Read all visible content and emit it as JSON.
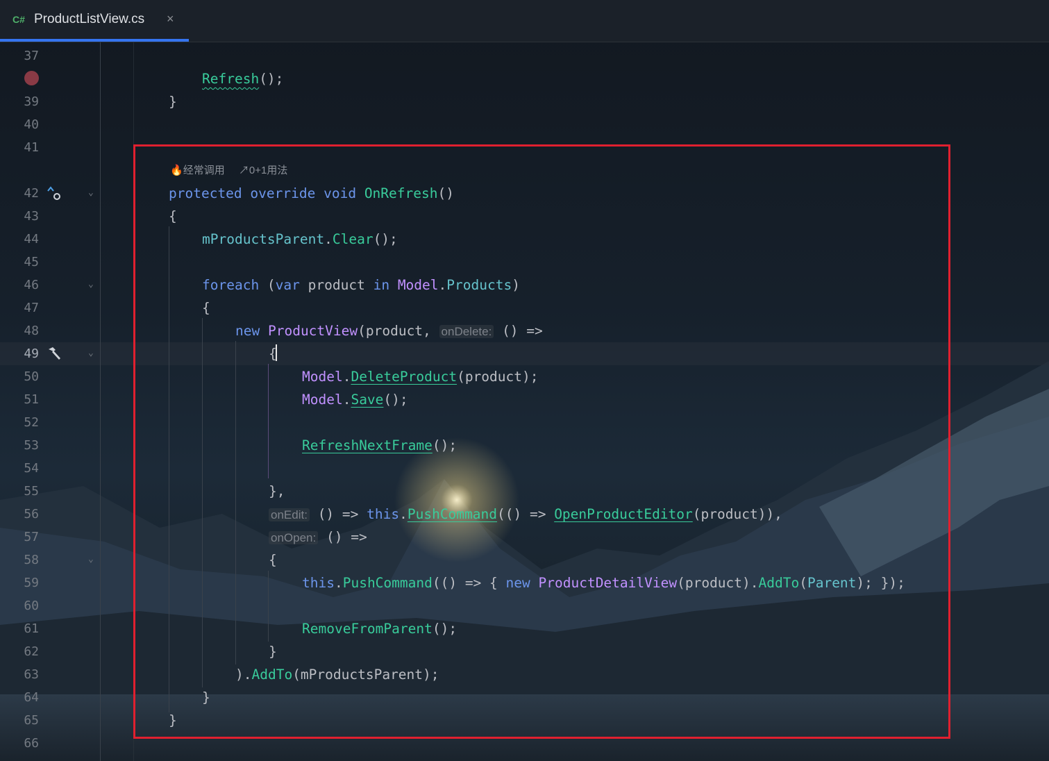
{
  "tab": {
    "lang": "C#",
    "filename": "ProductListView.cs",
    "close": "×"
  },
  "code_lens": {
    "usage_frequent": "经常调用",
    "usages": "0+1用法"
  },
  "hints": {
    "onDelete": "onDelete:",
    "onEdit": "onEdit:",
    "onOpen": "onOpen:"
  },
  "line_numbers": [
    "37",
    "39",
    "40",
    "41",
    "42",
    "43",
    "44",
    "45",
    "46",
    "47",
    "48",
    "49",
    "50",
    "51",
    "52",
    "53",
    "54",
    "55",
    "56",
    "57",
    "58",
    "59",
    "60",
    "61",
    "62",
    "63",
    "64",
    "65",
    "66"
  ],
  "code": {
    "l38_fn": "Refresh",
    "l38_rest": "();",
    "l39": "}",
    "l42_kw1": "protected",
    "l42_kw2": "override",
    "l42_kw3": "void",
    "l42_fn": "OnRefresh",
    "l42_rest": "()",
    "l43": "{",
    "l44_fld": "mProductsParent",
    "l44_dot": ".",
    "l44_fn": "Clear",
    "l44_rest": "();",
    "l46_kw1": "foreach",
    "l46_p1": " (",
    "l46_kw2": "var",
    "l46_p2": " product ",
    "l46_kw3": "in",
    "l46_ty": "Model",
    "l46_dot": ".",
    "l46_fld": "Products",
    "l46_end": ")",
    "l47": "{",
    "l48_kw": "new",
    "l48_ty": "ProductView",
    "l48_p1": "(product, ",
    "l48_end": "() =>",
    "l49": "{",
    "l50_ty": "Model",
    "l50_dot": ".",
    "l50_fn": "DeleteProduct",
    "l50_end": "(product);",
    "l51_ty": "Model",
    "l51_dot": ".",
    "l51_fn": "Save",
    "l51_end": "();",
    "l53_fn": "RefreshNextFrame",
    "l53_end": "();",
    "l55": "},",
    "l56_p1": "() => ",
    "l56_kw": "this",
    "l56_dot": ".",
    "l56_fn": "PushCommand",
    "l56_p2": "(() => ",
    "l56_fn2": "OpenProductEditor",
    "l56_end": "(product)),",
    "l57_end": "() =>",
    "l58": "{",
    "l59_kw": "this",
    "l59_dot": ".",
    "l59_fn": "PushCommand",
    "l59_p1": "(() => { ",
    "l59_kw2": "new",
    "l59_ty": "ProductDetailView",
    "l59_p2": "(product).",
    "l59_fn2": "AddTo",
    "l59_p3": "(",
    "l59_fld": "Parent",
    "l59_end": "); });",
    "l61_fn": "RemoveFromParent",
    "l61_end": "();",
    "l62": "}",
    "l63_p1": ").",
    "l63_fn": "AddTo",
    "l63_end": "(mProductsParent);",
    "l64": "}",
    "l65": "}"
  },
  "colors": {
    "keyword": "#6c95eb",
    "method": "#39cc9b",
    "type": "#c191ff",
    "field": "#66c3cc",
    "highlight_border": "#e0202f",
    "tab_accent": "#3574f0"
  }
}
